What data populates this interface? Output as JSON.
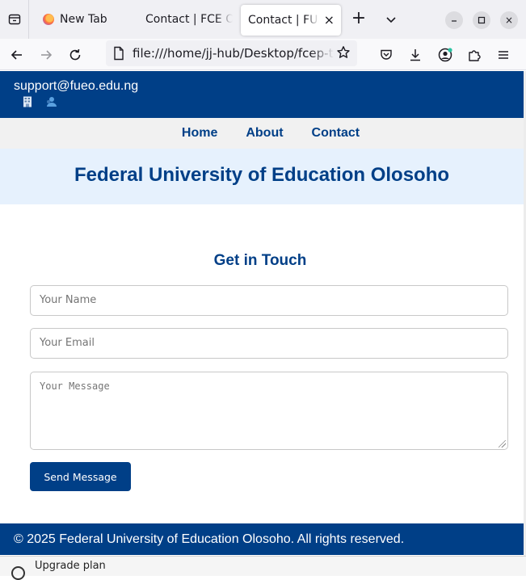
{
  "browser": {
    "tabs": [
      {
        "title": "New Tab",
        "active": false
      },
      {
        "title": "Contact | FCE Olosoho",
        "active": false
      },
      {
        "title": "Contact | FUEO",
        "active": true
      }
    ],
    "url": "file:///home/jj-hub/Desktop/fcep-temp/contact.html",
    "new_tab_symbol": "+",
    "close_symbol": "×",
    "icons": [
      "tab-list-icon",
      "firefox-icon",
      "close-icon",
      "plus-icon",
      "chevron-down-icon",
      "minimize-icon",
      "maximize-icon",
      "back-icon",
      "forward-icon",
      "reload-icon",
      "page-icon",
      "star-icon",
      "pocket-icon",
      "download-icon",
      "account-icon",
      "extensions-icon",
      "menu-icon"
    ]
  },
  "site": {
    "topbar": {
      "email": "support@fueo.edu.ng"
    },
    "nav": {
      "home": "Home",
      "about": "About",
      "contact": "Contact"
    },
    "hero_title": "Federal University of Education Olosoho",
    "contact": {
      "title": "Get in Touch",
      "name_placeholder": "Your Name",
      "email_placeholder": "Your Email",
      "message_placeholder": "Your Message",
      "send_label": "Send Message"
    },
    "footer": "© 2025 Federal University of Education Olosoho. All rights reserved."
  },
  "underlay": {
    "upgrade_label": "Upgrade plan"
  },
  "colors": {
    "primary": "#003f87",
    "hero_bg": "#e6f1fd",
    "menu_bg": "#f1f1f1"
  }
}
